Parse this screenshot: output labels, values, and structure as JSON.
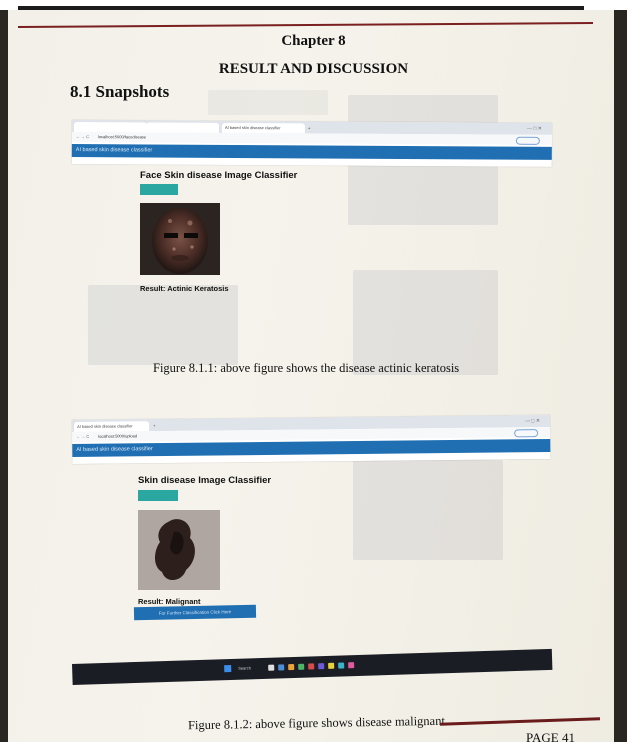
{
  "page": {
    "chapter": "Chapter 8",
    "chapter_title": "RESULT AND DISCUSSION",
    "section": "8.1 Snapshots",
    "footer": "PAGE 41"
  },
  "screenshot1": {
    "tabs": [
      "",
      "",
      "AI based skin disease classifier"
    ],
    "new_tab": "+",
    "window_controls": "—  □  ✕",
    "nav": "←  →  C",
    "url": "localhost:5000/facedisease",
    "app_bar": "AI based skin disease classifier",
    "heading": "Face Skin disease Image Classifier",
    "button": "",
    "result": "Result: Actinic Keratosis"
  },
  "screenshot2": {
    "tabs": [
      "AI based skin disease classifier"
    ],
    "new_tab": "+",
    "window_controls": "—  □  ✕",
    "nav": "←  →  C",
    "url": "localhost:5000/upload",
    "app_bar": "AI based skin disease classifier",
    "heading": "Skin disease Image Classifier",
    "button": "",
    "result": "Result: Malignant",
    "link_button": "For Further Classification Click Here"
  },
  "taskbar": {
    "weather": "",
    "search": "Search",
    "tray": ""
  },
  "figures": [
    {
      "caption": "Figure 8.1.1: above figure shows the disease actinic keratosis"
    },
    {
      "caption": "Figure 8.1.2: above figure shows disease malignant"
    }
  ]
}
